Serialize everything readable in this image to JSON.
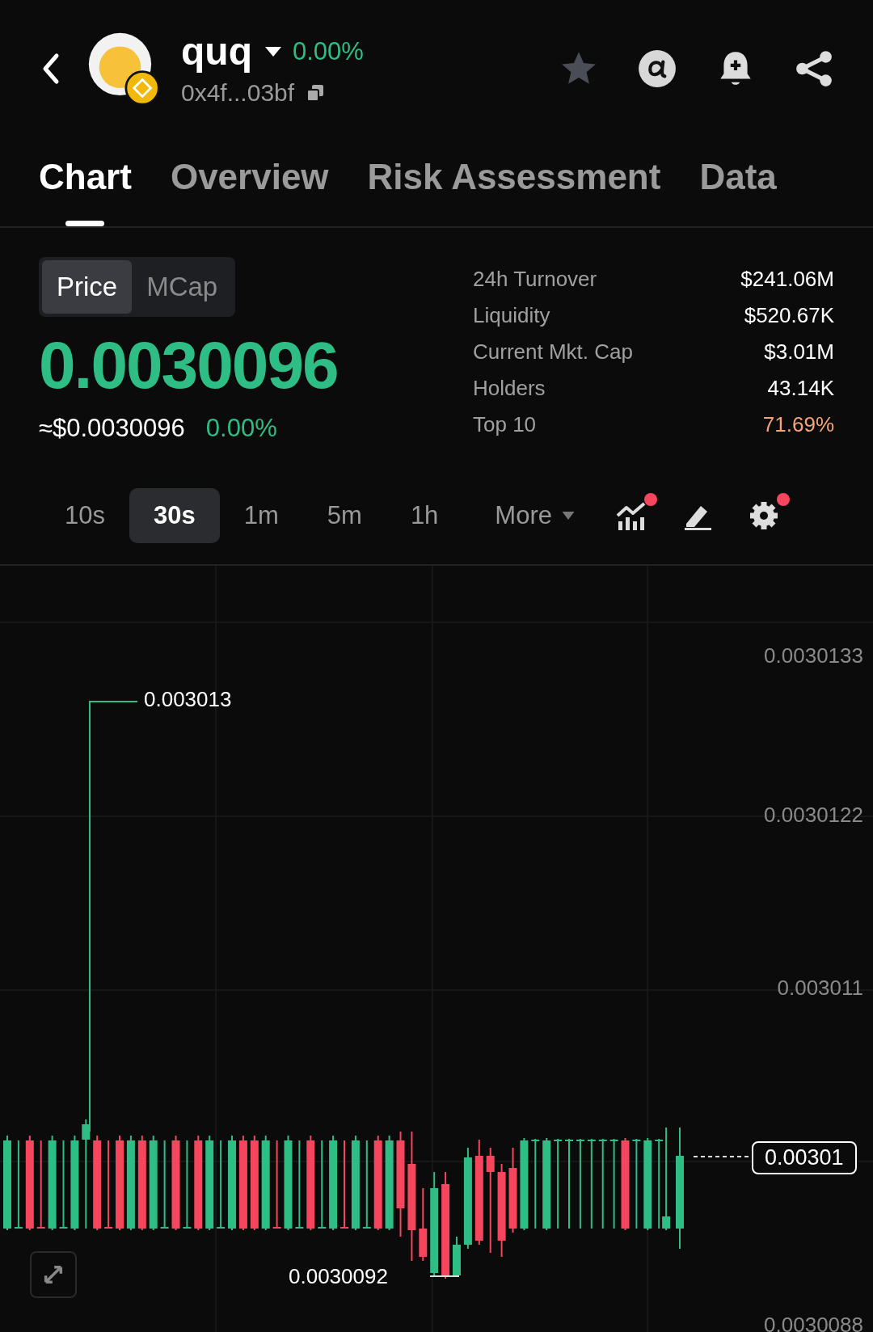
{
  "token": {
    "symbol": "quq",
    "change": "0.00%",
    "address": "0x4f...03bf"
  },
  "tabs": [
    {
      "label": "Chart",
      "selected": true
    },
    {
      "label": "Overview",
      "selected": false
    },
    {
      "label": "Risk Assessment",
      "selected": false
    },
    {
      "label": "Data",
      "selected": false
    }
  ],
  "price_toggle": [
    {
      "label": "Price",
      "selected": true
    },
    {
      "label": "MCap",
      "selected": false
    }
  ],
  "price": "0.0030096",
  "usd_price": "≈$0.0030096",
  "usd_change": "0.00%",
  "stats": [
    {
      "label": "24h Turnover",
      "value": "$241.06M",
      "color": "#ffffff"
    },
    {
      "label": "Liquidity",
      "value": "$520.67K",
      "color": "#ffffff"
    },
    {
      "label": "Current Mkt. Cap",
      "value": "$3.01M",
      "color": "#ffffff"
    },
    {
      "label": "Holders",
      "value": "43.14K",
      "color": "#ffffff"
    },
    {
      "label": "Top 10",
      "value": "71.69%",
      "color": "#f6a47a"
    }
  ],
  "timeframes": [
    {
      "label": "10s",
      "selected": false
    },
    {
      "label": "30s",
      "selected": true
    },
    {
      "label": "1m",
      "selected": false
    },
    {
      "label": "5m",
      "selected": false
    },
    {
      "label": "1h",
      "selected": false
    }
  ],
  "more": "More",
  "tools": [
    {
      "kind": "indicators",
      "dot": true
    },
    {
      "kind": "draw",
      "dot": false
    },
    {
      "kind": "settings",
      "dot": true
    }
  ],
  "chart": {
    "y_labels": [
      "0.0030133",
      "0.0030122",
      "0.003011",
      "0.0030088"
    ],
    "high_label": "0.003013",
    "low_label": "0.0030092",
    "last_price": "0.00301"
  }
}
